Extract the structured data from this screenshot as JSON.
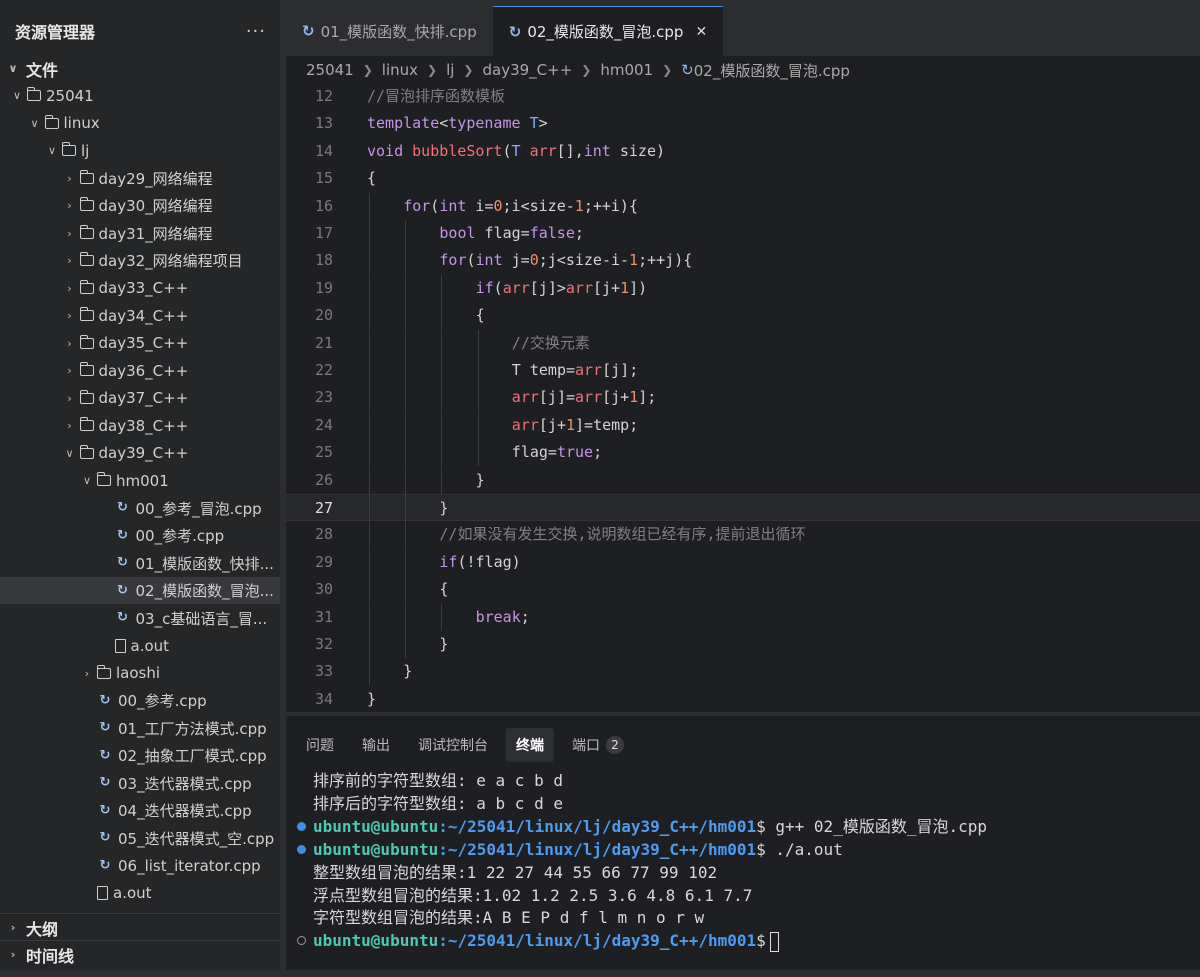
{
  "explorer": {
    "title": "资源管理器",
    "more": "···",
    "section_files": "文件",
    "tree": [
      {
        "label": "25041",
        "kind": "folder",
        "open": true,
        "depth": 0
      },
      {
        "label": "linux",
        "kind": "folder",
        "open": true,
        "depth": 1
      },
      {
        "label": "lj",
        "kind": "folder",
        "open": true,
        "depth": 2
      },
      {
        "label": "day29_网络编程",
        "kind": "folder",
        "open": false,
        "depth": 3
      },
      {
        "label": "day30_网络编程",
        "kind": "folder",
        "open": false,
        "depth": 3
      },
      {
        "label": "day31_网络编程",
        "kind": "folder",
        "open": false,
        "depth": 3
      },
      {
        "label": "day32_网络编程项目",
        "kind": "folder",
        "open": false,
        "depth": 3
      },
      {
        "label": "day33_C++",
        "kind": "folder",
        "open": false,
        "depth": 3
      },
      {
        "label": "day34_C++",
        "kind": "folder",
        "open": false,
        "depth": 3
      },
      {
        "label": "day35_C++",
        "kind": "folder",
        "open": false,
        "depth": 3
      },
      {
        "label": "day36_C++",
        "kind": "folder",
        "open": false,
        "depth": 3
      },
      {
        "label": "day37_C++",
        "kind": "folder",
        "open": false,
        "depth": 3
      },
      {
        "label": "day38_C++",
        "kind": "folder",
        "open": false,
        "depth": 3
      },
      {
        "label": "day39_C++",
        "kind": "folder",
        "open": true,
        "depth": 3
      },
      {
        "label": "hm001",
        "kind": "folder",
        "open": true,
        "depth": 4
      },
      {
        "label": "00_参考_冒泡.cpp",
        "kind": "cpp",
        "depth": 5
      },
      {
        "label": "00_参考.cpp",
        "kind": "cpp",
        "depth": 5
      },
      {
        "label": "01_模版函数_快排...",
        "kind": "cpp",
        "depth": 5
      },
      {
        "label": "02_模版函数_冒泡...",
        "kind": "cpp",
        "depth": 5,
        "selected": true
      },
      {
        "label": "03_c基础语言_冒...",
        "kind": "cpp",
        "depth": 5
      },
      {
        "label": "a.out",
        "kind": "file",
        "depth": 5
      },
      {
        "label": "laoshi",
        "kind": "folder",
        "open": false,
        "depth": 4
      },
      {
        "label": "00_参考.cpp",
        "kind": "cpp",
        "depth": 4
      },
      {
        "label": "01_工厂方法模式.cpp",
        "kind": "cpp",
        "depth": 4
      },
      {
        "label": "02_抽象工厂模式.cpp",
        "kind": "cpp",
        "depth": 4
      },
      {
        "label": "03_迭代器模式.cpp",
        "kind": "cpp",
        "depth": 4
      },
      {
        "label": "04_迭代器模式.cpp",
        "kind": "cpp",
        "depth": 4
      },
      {
        "label": "05_迭代器模式_空.cpp",
        "kind": "cpp",
        "depth": 4
      },
      {
        "label": "06_list_iterator.cpp",
        "kind": "cpp",
        "depth": 4
      },
      {
        "label": "a.out",
        "kind": "file",
        "depth": 4
      }
    ],
    "section_outline": "大纲",
    "section_timeline": "时间线"
  },
  "tabs": [
    {
      "label": "01_模版函数_快排.cpp",
      "active": false
    },
    {
      "label": "02_模版函数_冒泡.cpp",
      "active": true
    }
  ],
  "breadcrumb": [
    "25041",
    "linux",
    "lj",
    "day39_C++",
    "hm001",
    "02_模版函数_冒泡.cpp"
  ],
  "code": {
    "current_line": 27,
    "lines": [
      {
        "n": 12,
        "indent": 0,
        "tokens": [
          [
            "cm",
            "//冒泡排序函数模板"
          ]
        ]
      },
      {
        "n": 13,
        "indent": 0,
        "tokens": [
          [
            "kw",
            "template"
          ],
          [
            "",
            "<"
          ],
          [
            "kw",
            "typename"
          ],
          [
            "",
            " "
          ],
          [
            "ty",
            "T"
          ],
          [
            "",
            ">"
          ]
        ]
      },
      {
        "n": 14,
        "indent": 0,
        "tokens": [
          [
            "kw",
            "void"
          ],
          [
            "",
            " "
          ],
          [
            "fn",
            "bubbleSort"
          ],
          [
            "",
            "("
          ],
          [
            "ty",
            "T"
          ],
          [
            "",
            " "
          ],
          [
            "fn",
            "arr"
          ],
          [
            "",
            "[],"
          ],
          [
            "kw",
            "int"
          ],
          [
            "",
            " size)"
          ]
        ]
      },
      {
        "n": 15,
        "indent": 0,
        "tokens": [
          [
            "",
            "{"
          ]
        ]
      },
      {
        "n": 16,
        "indent": 1,
        "tokens": [
          [
            "kw",
            "for"
          ],
          [
            "",
            "("
          ],
          [
            "kw",
            "int"
          ],
          [
            "",
            " i="
          ],
          [
            "num",
            "0"
          ],
          [
            "",
            ";i<size-"
          ],
          [
            "num",
            "1"
          ],
          [
            "",
            ";++i){"
          ]
        ]
      },
      {
        "n": 17,
        "indent": 2,
        "tokens": [
          [
            "kw",
            "bool"
          ],
          [
            "",
            " flag="
          ],
          [
            "kw",
            "false"
          ],
          [
            "",
            ";"
          ]
        ]
      },
      {
        "n": 18,
        "indent": 2,
        "tokens": [
          [
            "kw",
            "for"
          ],
          [
            "",
            "("
          ],
          [
            "kw",
            "int"
          ],
          [
            "",
            " j="
          ],
          [
            "num",
            "0"
          ],
          [
            "",
            ";j<size-i-"
          ],
          [
            "num",
            "1"
          ],
          [
            "",
            ";++j){"
          ]
        ]
      },
      {
        "n": 19,
        "indent": 3,
        "tokens": [
          [
            "kw",
            "if"
          ],
          [
            "",
            "("
          ],
          [
            "fn",
            "arr"
          ],
          [
            "",
            "[j]>"
          ],
          [
            "fn",
            "arr"
          ],
          [
            "",
            "[j+"
          ],
          [
            "num",
            "1"
          ],
          [
            "",
            "])"
          ]
        ]
      },
      {
        "n": 20,
        "indent": 3,
        "tokens": [
          [
            "",
            "{"
          ]
        ]
      },
      {
        "n": 21,
        "indent": 4,
        "tokens": [
          [
            "cm",
            "//交换元素"
          ]
        ]
      },
      {
        "n": 22,
        "indent": 4,
        "tokens": [
          [
            "",
            "T temp="
          ],
          [
            "fn",
            "arr"
          ],
          [
            "",
            "[j];"
          ]
        ]
      },
      {
        "n": 23,
        "indent": 4,
        "tokens": [
          [
            "fn",
            "arr"
          ],
          [
            "",
            "[j]="
          ],
          [
            "fn",
            "arr"
          ],
          [
            "",
            "[j+"
          ],
          [
            "num",
            "1"
          ],
          [
            "",
            "];"
          ]
        ]
      },
      {
        "n": 24,
        "indent": 4,
        "tokens": [
          [
            "fn",
            "arr"
          ],
          [
            "",
            "[j+"
          ],
          [
            "num",
            "1"
          ],
          [
            "",
            "]=temp;"
          ]
        ]
      },
      {
        "n": 25,
        "indent": 4,
        "tokens": [
          [
            "",
            "flag="
          ],
          [
            "kw",
            "true"
          ],
          [
            "",
            ";"
          ]
        ]
      },
      {
        "n": 26,
        "indent": 3,
        "tokens": [
          [
            "",
            "}"
          ]
        ]
      },
      {
        "n": 27,
        "indent": 2,
        "tokens": [
          [
            "",
            "}"
          ]
        ]
      },
      {
        "n": 28,
        "indent": 2,
        "tokens": [
          [
            "cm",
            "//如果没有发生交换,说明数组已经有序,提前退出循环"
          ]
        ]
      },
      {
        "n": 29,
        "indent": 2,
        "tokens": [
          [
            "kw",
            "if"
          ],
          [
            "",
            "(!flag)"
          ]
        ]
      },
      {
        "n": 30,
        "indent": 2,
        "tokens": [
          [
            "",
            "{"
          ]
        ]
      },
      {
        "n": 31,
        "indent": 3,
        "tokens": [
          [
            "kw",
            "break"
          ],
          [
            "",
            ";"
          ]
        ]
      },
      {
        "n": 32,
        "indent": 2,
        "tokens": [
          [
            "",
            "}"
          ]
        ]
      },
      {
        "n": 33,
        "indent": 1,
        "tokens": [
          [
            "",
            "}"
          ]
        ]
      },
      {
        "n": 34,
        "indent": 0,
        "tokens": [
          [
            "",
            "}"
          ]
        ]
      }
    ]
  },
  "panel": {
    "tabs": [
      {
        "label": "问题",
        "active": false
      },
      {
        "label": "输出",
        "active": false
      },
      {
        "label": "调试控制台",
        "active": false
      },
      {
        "label": "终端",
        "active": true
      },
      {
        "label": "端口",
        "active": false,
        "badge": "2"
      }
    ],
    "terminal": [
      {
        "dot": "none",
        "prompt": false,
        "text": "排序前的字符型数组: e a c b d"
      },
      {
        "dot": "none",
        "prompt": false,
        "text": "排序后的字符型数组: a b c d e"
      },
      {
        "dot": "filled",
        "prompt": true,
        "user": "ubuntu@ubuntu",
        "path": ":~/25041/linux/lj/day39_C++/hm001",
        "cmd": "$ g++ 02_模版函数_冒泡.cpp"
      },
      {
        "dot": "filled",
        "prompt": true,
        "user": "ubuntu@ubuntu",
        "path": ":~/25041/linux/lj/day39_C++/hm001",
        "cmd": "$ ./a.out"
      },
      {
        "dot": "none",
        "prompt": false,
        "text": "整型数组冒泡的结果:1 22 27 44 55 66 77 99 102"
      },
      {
        "dot": "none",
        "prompt": false,
        "text": "浮点型数组冒泡的结果:1.02 1.2 2.5 3.6 4.8 6.1 7.7"
      },
      {
        "dot": "none",
        "prompt": false,
        "text": "字符型数组冒泡的结果:A B E P d f l m n o r w"
      },
      {
        "dot": "hollow",
        "prompt": true,
        "user": "ubuntu@ubuntu",
        "path": ":~/25041/linux/lj/day39_C++/hm001",
        "cmd": "$",
        "cursor": true
      }
    ]
  },
  "colors": {
    "accent": "#4a90e2",
    "keyword": "#c792ea",
    "function": "#f07178",
    "number": "#f78c6c",
    "comment": "#808080",
    "prompt_user": "#4ec9b0",
    "prompt_path": "#4d9cf0"
  }
}
